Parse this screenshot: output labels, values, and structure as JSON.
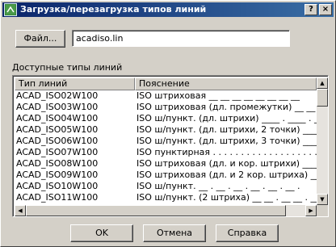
{
  "window": {
    "title": "Загрузка/перезагрузка типов линий",
    "help_label": "?",
    "close_label": "×"
  },
  "file": {
    "button_label": "Файл...",
    "value": "acadiso.lin"
  },
  "list": {
    "caption": "Доступные типы линий",
    "col_type": "Тип линий",
    "col_desc": "Пояснение",
    "rows": [
      {
        "type": "ACAD_ISO02W100",
        "desc": "ISO штриховая __ __ __ __ __ __ __ __"
      },
      {
        "type": "ACAD_ISO03W100",
        "desc": "ISO штриховая (дл. промежутки) __   __   __"
      },
      {
        "type": "ACAD_ISO04W100",
        "desc": "ISO ш/пункт. (дл. штрихи) ____ . ____ . ____"
      },
      {
        "type": "ACAD_ISO05W100",
        "desc": "ISO ш/пункт. (дл. штрихи, 2 точки) ____ .. __"
      },
      {
        "type": "ACAD_ISO06W100",
        "desc": "ISO ш/пункт. (дл. штрихи, 3 точки) ____ ... _"
      },
      {
        "type": "ACAD_ISO07W100",
        "desc": "ISO пунктирная . . . . . . . . . . . . . . . . . . ."
      },
      {
        "type": "ACAD_ISO08W100",
        "desc": "ISO штриховая (дл. и кор. штрихи) ____ __ __"
      },
      {
        "type": "ACAD_ISO09W100",
        "desc": "ISO штриховая (дл. и 2 кор. штриха) ____ __ __"
      },
      {
        "type": "ACAD_ISO10W100",
        "desc": "ISO ш/пункт. __ . __ . __ . __ . __ . __ ."
      },
      {
        "type": "ACAD_ISO11W100",
        "desc": "ISO ш/пункт. (2 штриха) __ __ . __ __ . __ __"
      }
    ]
  },
  "buttons": {
    "ok": "OK",
    "cancel": "Отмена",
    "help": "Справка"
  },
  "scrollbar": {
    "up": "▲",
    "down": "▼",
    "left": "◀",
    "right": "▶"
  }
}
